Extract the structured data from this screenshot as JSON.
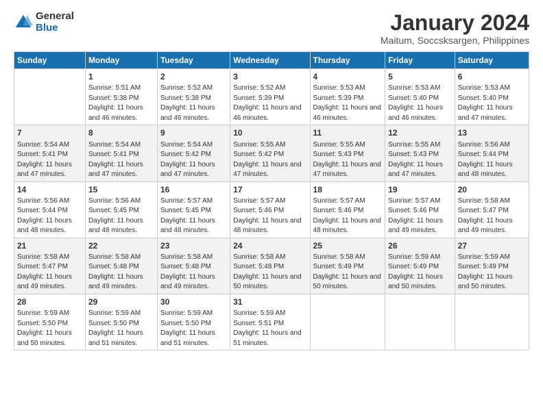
{
  "logo": {
    "general": "General",
    "blue": "Blue"
  },
  "title": "January 2024",
  "subtitle": "Maitum, Soccsksargen, Philippines",
  "days_header": [
    "Sunday",
    "Monday",
    "Tuesday",
    "Wednesday",
    "Thursday",
    "Friday",
    "Saturday"
  ],
  "weeks": [
    [
      {
        "day": "",
        "sunrise": "",
        "sunset": "",
        "daylight": ""
      },
      {
        "day": "1",
        "sunrise": "Sunrise: 5:51 AM",
        "sunset": "Sunset: 5:38 PM",
        "daylight": "Daylight: 11 hours and 46 minutes."
      },
      {
        "day": "2",
        "sunrise": "Sunrise: 5:52 AM",
        "sunset": "Sunset: 5:38 PM",
        "daylight": "Daylight: 11 hours and 46 minutes."
      },
      {
        "day": "3",
        "sunrise": "Sunrise: 5:52 AM",
        "sunset": "Sunset: 5:39 PM",
        "daylight": "Daylight: 11 hours and 46 minutes."
      },
      {
        "day": "4",
        "sunrise": "Sunrise: 5:53 AM",
        "sunset": "Sunset: 5:39 PM",
        "daylight": "Daylight: 11 hours and 46 minutes."
      },
      {
        "day": "5",
        "sunrise": "Sunrise: 5:53 AM",
        "sunset": "Sunset: 5:40 PM",
        "daylight": "Daylight: 11 hours and 46 minutes."
      },
      {
        "day": "6",
        "sunrise": "Sunrise: 5:53 AM",
        "sunset": "Sunset: 5:40 PM",
        "daylight": "Daylight: 11 hours and 47 minutes."
      }
    ],
    [
      {
        "day": "7",
        "sunrise": "Sunrise: 5:54 AM",
        "sunset": "Sunset: 5:41 PM",
        "daylight": "Daylight: 11 hours and 47 minutes."
      },
      {
        "day": "8",
        "sunrise": "Sunrise: 5:54 AM",
        "sunset": "Sunset: 5:41 PM",
        "daylight": "Daylight: 11 hours and 47 minutes."
      },
      {
        "day": "9",
        "sunrise": "Sunrise: 5:54 AM",
        "sunset": "Sunset: 5:42 PM",
        "daylight": "Daylight: 11 hours and 47 minutes."
      },
      {
        "day": "10",
        "sunrise": "Sunrise: 5:55 AM",
        "sunset": "Sunset: 5:42 PM",
        "daylight": "Daylight: 11 hours and 47 minutes."
      },
      {
        "day": "11",
        "sunrise": "Sunrise: 5:55 AM",
        "sunset": "Sunset: 5:43 PM",
        "daylight": "Daylight: 11 hours and 47 minutes."
      },
      {
        "day": "12",
        "sunrise": "Sunrise: 5:55 AM",
        "sunset": "Sunset: 5:43 PM",
        "daylight": "Daylight: 11 hours and 47 minutes."
      },
      {
        "day": "13",
        "sunrise": "Sunrise: 5:56 AM",
        "sunset": "Sunset: 5:44 PM",
        "daylight": "Daylight: 11 hours and 48 minutes."
      }
    ],
    [
      {
        "day": "14",
        "sunrise": "Sunrise: 5:56 AM",
        "sunset": "Sunset: 5:44 PM",
        "daylight": "Daylight: 11 hours and 48 minutes."
      },
      {
        "day": "15",
        "sunrise": "Sunrise: 5:56 AM",
        "sunset": "Sunset: 5:45 PM",
        "daylight": "Daylight: 11 hours and 48 minutes."
      },
      {
        "day": "16",
        "sunrise": "Sunrise: 5:57 AM",
        "sunset": "Sunset: 5:45 PM",
        "daylight": "Daylight: 11 hours and 48 minutes."
      },
      {
        "day": "17",
        "sunrise": "Sunrise: 5:57 AM",
        "sunset": "Sunset: 5:46 PM",
        "daylight": "Daylight: 11 hours and 48 minutes."
      },
      {
        "day": "18",
        "sunrise": "Sunrise: 5:57 AM",
        "sunset": "Sunset: 5:46 PM",
        "daylight": "Daylight: 11 hours and 48 minutes."
      },
      {
        "day": "19",
        "sunrise": "Sunrise: 5:57 AM",
        "sunset": "Sunset: 5:46 PM",
        "daylight": "Daylight: 11 hours and 49 minutes."
      },
      {
        "day": "20",
        "sunrise": "Sunrise: 5:58 AM",
        "sunset": "Sunset: 5:47 PM",
        "daylight": "Daylight: 11 hours and 49 minutes."
      }
    ],
    [
      {
        "day": "21",
        "sunrise": "Sunrise: 5:58 AM",
        "sunset": "Sunset: 5:47 PM",
        "daylight": "Daylight: 11 hours and 49 minutes."
      },
      {
        "day": "22",
        "sunrise": "Sunrise: 5:58 AM",
        "sunset": "Sunset: 5:48 PM",
        "daylight": "Daylight: 11 hours and 49 minutes."
      },
      {
        "day": "23",
        "sunrise": "Sunrise: 5:58 AM",
        "sunset": "Sunset: 5:48 PM",
        "daylight": "Daylight: 11 hours and 49 minutes."
      },
      {
        "day": "24",
        "sunrise": "Sunrise: 5:58 AM",
        "sunset": "Sunset: 5:48 PM",
        "daylight": "Daylight: 11 hours and 50 minutes."
      },
      {
        "day": "25",
        "sunrise": "Sunrise: 5:58 AM",
        "sunset": "Sunset: 5:49 PM",
        "daylight": "Daylight: 11 hours and 50 minutes."
      },
      {
        "day": "26",
        "sunrise": "Sunrise: 5:59 AM",
        "sunset": "Sunset: 5:49 PM",
        "daylight": "Daylight: 11 hours and 50 minutes."
      },
      {
        "day": "27",
        "sunrise": "Sunrise: 5:59 AM",
        "sunset": "Sunset: 5:49 PM",
        "daylight": "Daylight: 11 hours and 50 minutes."
      }
    ],
    [
      {
        "day": "28",
        "sunrise": "Sunrise: 5:59 AM",
        "sunset": "Sunset: 5:50 PM",
        "daylight": "Daylight: 11 hours and 50 minutes."
      },
      {
        "day": "29",
        "sunrise": "Sunrise: 5:59 AM",
        "sunset": "Sunset: 5:50 PM",
        "daylight": "Daylight: 11 hours and 51 minutes."
      },
      {
        "day": "30",
        "sunrise": "Sunrise: 5:59 AM",
        "sunset": "Sunset: 5:50 PM",
        "daylight": "Daylight: 11 hours and 51 minutes."
      },
      {
        "day": "31",
        "sunrise": "Sunrise: 5:59 AM",
        "sunset": "Sunset: 5:51 PM",
        "daylight": "Daylight: 11 hours and 51 minutes."
      },
      {
        "day": "",
        "sunrise": "",
        "sunset": "",
        "daylight": ""
      },
      {
        "day": "",
        "sunrise": "",
        "sunset": "",
        "daylight": ""
      },
      {
        "day": "",
        "sunrise": "",
        "sunset": "",
        "daylight": ""
      }
    ]
  ]
}
